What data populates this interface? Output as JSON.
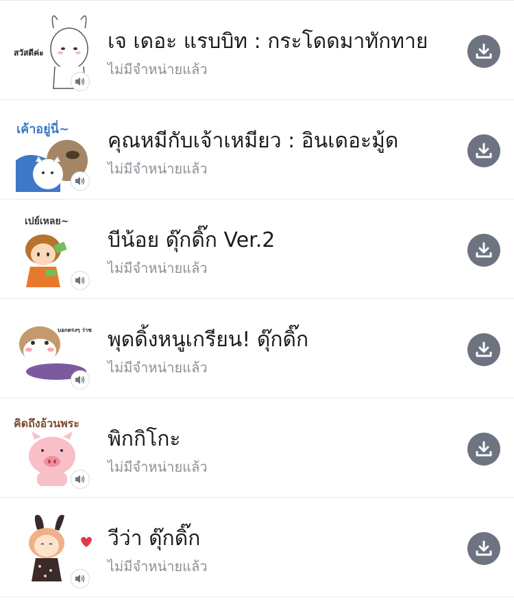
{
  "colors": {
    "title": "#1b1b1b",
    "subtitle": "#8c8f96",
    "download_button": "#6e7381",
    "divider": "#e9e9ea"
  },
  "sticker_list": {
    "items": [
      {
        "title": "เจ เดอะ แรบบิท : กระโดดมาทักทาย",
        "status": "ไม่มีจำหน่ายแล้ว",
        "thumbnail_caption": "สวัสดีค่ะ",
        "thumbnail_icon": "white-rabbit-sticker",
        "sound_icon": "sound-badge-icon",
        "action_icon": "download-icon"
      },
      {
        "title": "คุณหมีกับเจ้าเหมียว : อินเดอะมู้ด",
        "status": "ไม่มีจำหน่ายแล้ว",
        "thumbnail_caption": "เค้าอยู่นี่~",
        "thumbnail_icon": "bear-and-cat-sticker",
        "sound_icon": "sound-badge-icon",
        "action_icon": "download-icon"
      },
      {
        "title": "บีน้อย ดุ๊กดิ๊ก Ver.2",
        "status": "ไม่มีจำหน่ายแล้ว",
        "thumbnail_caption": "เปย์เหลย~",
        "thumbnail_icon": "boy-with-money-sticker",
        "sound_icon": "sound-badge-icon",
        "action_icon": "download-icon"
      },
      {
        "title": "พุดดิ้งหนูเกรียน! ดุ๊กดิ๊ก",
        "status": "ไม่มีจำหน่ายแล้ว",
        "thumbnail_caption": "บอกตรงๆ ว่าชอบ เผือก มาก",
        "thumbnail_icon": "hamster-sticker",
        "sound_icon": "sound-badge-icon",
        "action_icon": "download-icon"
      },
      {
        "title": "พิกกิโกะ",
        "status": "ไม่มีจำหน่ายแล้ว",
        "thumbnail_caption": "คิดถึงอ้วนพระ",
        "thumbnail_icon": "pink-pig-sticker",
        "sound_icon": "sound-badge-icon",
        "action_icon": "download-icon"
      },
      {
        "title": "วีว่า ดุ๊กดิ๊ก",
        "status": "ไม่มีจำหน่ายแล้ว",
        "thumbnail_caption": "",
        "thumbnail_icon": "bunny-girl-sticker",
        "sound_icon": "sound-badge-icon",
        "action_icon": "download-icon"
      }
    ]
  }
}
